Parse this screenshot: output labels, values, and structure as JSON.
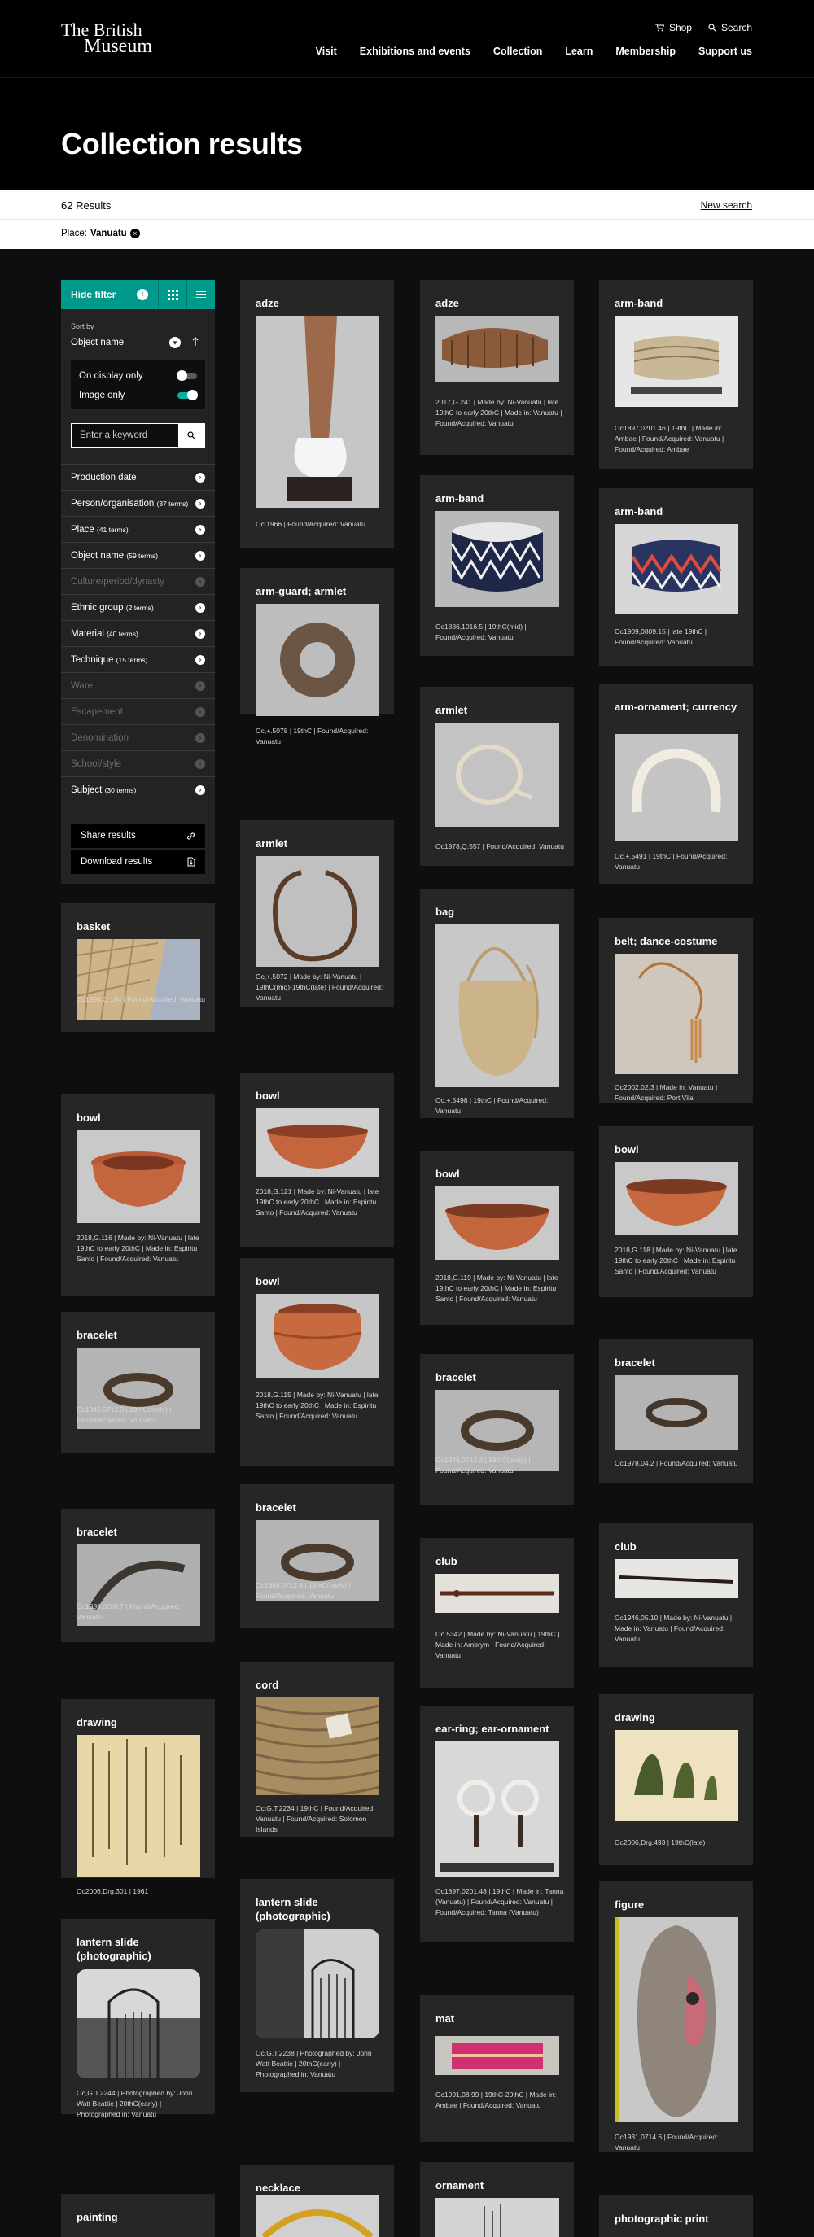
{
  "header": {
    "logo_line1": "The British",
    "logo_line2": "Museum",
    "util": {
      "shop": "Shop",
      "search": "Search"
    },
    "nav": [
      "Visit",
      "Exhibitions and events",
      "Collection",
      "Learn",
      "Membership",
      "Support us"
    ]
  },
  "page": {
    "title": "Collection results",
    "results_count": "62 Results",
    "new_search": "New search",
    "filter_label": "Place:",
    "filter_value": "Vanuatu"
  },
  "sidebar": {
    "hide_filter": "Hide filter",
    "sort_by_label": "Sort by",
    "sort_value": "Object name",
    "on_display_only": "On display only",
    "image_only": "Image only",
    "keyword_placeholder": "Enter a keyword",
    "facets": [
      {
        "label": "Production date",
        "count": "",
        "state": "normal"
      },
      {
        "label": "Person/organisation",
        "count": "(37 terms)",
        "state": "normal"
      },
      {
        "label": "Place",
        "count": "(41 terms)",
        "state": "active"
      },
      {
        "label": "Object name",
        "count": "(59 terms)",
        "state": "normal"
      },
      {
        "label": "Culture/period/dynasty",
        "count": "",
        "state": "disabled"
      },
      {
        "label": "Ethnic group",
        "count": "(2 terms)",
        "state": "normal"
      },
      {
        "label": "Material",
        "count": "(40 terms)",
        "state": "normal"
      },
      {
        "label": "Technique",
        "count": "(15 terms)",
        "state": "normal"
      },
      {
        "label": "Ware",
        "count": "",
        "state": "disabled"
      },
      {
        "label": "Escapement",
        "count": "",
        "state": "disabled"
      },
      {
        "label": "Denomination",
        "count": "",
        "state": "disabled"
      },
      {
        "label": "School/style",
        "count": "",
        "state": "disabled"
      },
      {
        "label": "Subject",
        "count": "(30 terms)",
        "state": "normal"
      }
    ],
    "share_results": "Share results",
    "download_results": "Download results"
  },
  "cards": {
    "c1": {
      "title": "adze",
      "desc": "Oc.1966  |  Found/Acquired: Vanuatu"
    },
    "c2": {
      "title": "adze",
      "desc": "2017,G.241  |  Made by: Ni-Vanuatu  |  late 19thC to early 20thC  |  Made in: Vanuatu  |  Found/Acquired: Vanuatu"
    },
    "c3": {
      "title": "arm-band",
      "desc": "Oc1897,0201.46  |  19thC  |  Made in: Ambae  |  Found/Acquired: Vanuatu  |  Found/Acquired: Ambae"
    },
    "c4": {
      "title": "arm-band",
      "desc": "Oc1886,1016.5  |  19thC(mid)  |  Found/Acquired: Vanuatu"
    },
    "c5": {
      "title": "arm-band",
      "desc": "Oc1909,0809.15  |  late 19thC  |  Found/Acquired: Vanuatu"
    },
    "c6": {
      "title": "arm-guard; armlet",
      "desc": "Oc,+.5078  |  19thC  |  Found/Acquired: Vanuatu"
    },
    "c7": {
      "title": "armlet",
      "desc": "Oc1978,Q.557  |  Found/Acquired: Vanuatu"
    },
    "c8": {
      "title": "arm-ornament; currency",
      "desc": "Oc,+.5491  |  19thC  |  Found/Acquired: Vanuatu"
    },
    "c9": {
      "title": "armlet",
      "desc": "Oc,+.5072  |  Made by: Ni-Vanuatu  |  19thC(mid)-19thC(late)  |  Found/Acquired: Vanuatu"
    },
    "c10": {
      "title": "bag",
      "desc": "Oc,+.5498  |  19thC  |  Found/Acquired: Vanuatu"
    },
    "c11": {
      "title": "basket",
      "desc": "Oc1998,Q.184  |  Found/Acquired: Vanuatu"
    },
    "c12": {
      "title": "belt; dance-costume",
      "desc": "Oc2002,02.3  |  Made in: Vanuatu  |  Found/Acquired: Port Vila"
    },
    "c13": {
      "title": "bowl",
      "desc": "2018,G.121  |  Made by: Ni-Vanuatu  |  late 19thC to early 20thC  |  Made in: Espiritu Santo  |  Found/Acquired: Vanuatu"
    },
    "c14": {
      "title": "bowl",
      "desc": "2018,G.116  |  Made by: Ni-Vanuatu  |  late 19thC to early 20thC  |  Made in: Espiritu Santo  |  Found/Acquired: Vanuatu"
    },
    "c15": {
      "title": "bowl",
      "desc": "2018,G.119  |  Made by: Ni-Vanuatu  |  late 19thC to early 20thC  |  Made in: Espiritu Santo  |  Found/Acquired: Vanuatu"
    },
    "c16": {
      "title": "bowl",
      "desc": "2018,G.118  |  Made by: Ni-Vanuatu  |  late 19thC to early 20thC  |  Made in: Espiritu Santo  |  Found/Acquired: Vanuatu"
    },
    "c17": {
      "title": "bowl",
      "desc": "2018,G.115  |  Made by: Ni-Vanuatu  |  late 19thC to early 20thC  |  Made in: Espiritu Santo  |  Found/Acquired: Vanuatu"
    },
    "c18": {
      "title": "bracelet",
      "desc": "Oc1846,0712.3  |  19thC(early)  |  Found/Acquired: Vanuatu"
    },
    "c19": {
      "title": "bracelet",
      "desc": "Oc1846,0712.2  |  19thC(early)  |  Found/Acquired: Vanuatu"
    },
    "c20": {
      "title": "bracelet",
      "desc": "Oc1978,04.2  |  Found/Acquired: Vanuatu"
    },
    "c21": {
      "title": "bracelet",
      "desc": "Oc1846,0712.4  |  19thC(early)  |  Found/Acquired: Vanuatu"
    },
    "c22": {
      "title": "bracelet",
      "desc": "Oc1889,0208.7  |  Found/Acquired: Vanuatu"
    },
    "c23": {
      "title": "club",
      "desc": "Oc.5342  |  Made by: Ni-Vanuatu  |  19thC  |  Made in: Ambrym  |  Found/Acquired: Vanuatu"
    },
    "c24": {
      "title": "club",
      "desc": "Oc1946,05.10  |  Made by: Ni-Vanuatu  |  Made in: Vanuatu  |  Found/Acquired: Vanuatu"
    },
    "c25": {
      "title": "cord",
      "desc": "Oc,G.T.2234  |  19thC  |  Found/Acquired: Vanuatu  |  Found/Acquired: Solomon Islands"
    },
    "c26": {
      "title": "drawing",
      "desc": "Oc2006,Drg.301  |  1961"
    },
    "c27": {
      "title": "ear-ring; ear-ornament",
      "desc": "Oc1897,0201.48  |  19thC  |  Made in: Tanna (Vanuatu)  |  Found/Acquired: Vanuatu  |  Found/Acquired: Tanna (Vanuatu)"
    },
    "c28": {
      "title": "drawing",
      "desc": "Oc2006,Drg.493  |  19thC(late)"
    },
    "c29": {
      "title": "lantern slide (photographic)",
      "desc": "Oc,G.T.2238  |  Photographed by: John Watt Beattie  |  20thC(early)  |  Photographed in: Vanuatu"
    },
    "c30": {
      "title": "figure",
      "desc": "Oc1931,0714.6  |  Found/Acquired: Vanuatu"
    },
    "c31": {
      "title": "lantern slide (photographic)",
      "desc": "Oc,G.T.2244  |  Photographed by: John Watt Beattie  |  20thC(early)  |  Photographed in: Vanuatu"
    },
    "c32": {
      "title": "mat",
      "desc": "Oc1991,08.99  |  19thC-20thC  |  Made in: Ambae  |  Found/Acquired: Vanuatu"
    },
    "c33": {
      "title": "necklace",
      "desc": ""
    },
    "c34": {
      "title": "ornament",
      "desc": ""
    },
    "c35": {
      "title": "painting",
      "desc": ""
    },
    "c36": {
      "title": "photographic print",
      "desc": ""
    }
  }
}
